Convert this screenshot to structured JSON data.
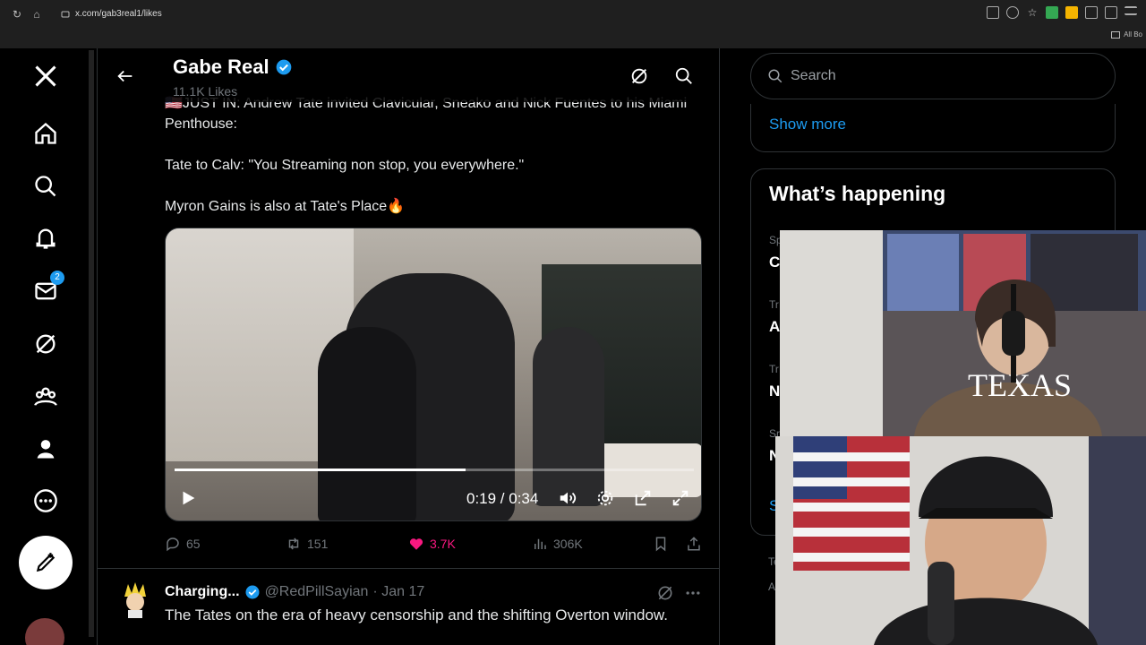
{
  "browser": {
    "url": "x.com/gab3real1/likes",
    "bookmarks_label": "All Bo"
  },
  "nav": {
    "messages_badge": "2"
  },
  "header": {
    "title": "Gabe Real",
    "subtitle": "11.1K Likes"
  },
  "tweet": {
    "lines": [
      "🇺🇸JUST IN: Andrew Tate invited Clavicular, Sneako and Nick Fuentes to his Miami Penthouse:",
      "Tate to Calv: \"You Streaming non stop, you everywhere.\"",
      "Myron Gains is also at Tate's Place🔥"
    ],
    "video": {
      "time": "0:19 / 0:34",
      "progress_fraction": 0.56
    },
    "stats": {
      "replies": "65",
      "retweets": "151",
      "likes": "3.7K",
      "views": "306K"
    }
  },
  "tweet2": {
    "name": "Charging...",
    "handle": "@RedPillSayian",
    "date": "· Jan 17",
    "text": "The Tates on the era of heavy censorship and the shifting Overton window."
  },
  "right": {
    "search_placeholder": "Search",
    "show_more": "Show more",
    "whats_happening": "What’s happening",
    "trend_fragments": [
      "Sp",
      "C",
      "Tr",
      "A",
      "Tr",
      "N",
      "Sr",
      "N",
      "S"
    ],
    "lower_fragments": [
      "Te",
      "A"
    ]
  },
  "colors": {
    "accent": "#1d9bf0",
    "like": "#f91880",
    "background": "#000000"
  }
}
